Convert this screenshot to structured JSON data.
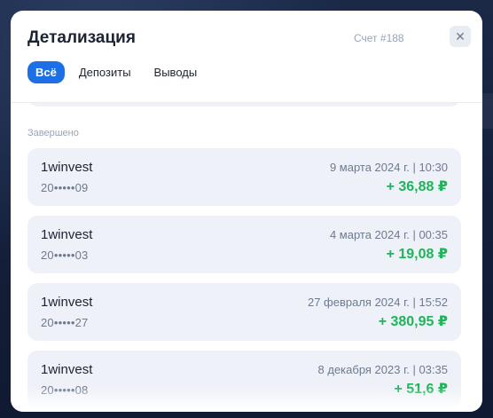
{
  "modal": {
    "title": "Детализация",
    "account_label": "Счет #188",
    "close_icon": "close-icon",
    "tabs": [
      {
        "label": "Всё",
        "active": true
      },
      {
        "label": "Депозиты",
        "active": false
      },
      {
        "label": "Выводы",
        "active": false
      }
    ],
    "section_label": "Завершено",
    "transactions": [
      {
        "name": "1winvest",
        "account": "20•••••09",
        "date": "9 марта 2024 г. | 10:30",
        "amount": "+ 36,88 ₽"
      },
      {
        "name": "1winvest",
        "account": "20•••••03",
        "date": "4 марта 2024 г. | 00:35",
        "amount": "+ 19,08 ₽"
      },
      {
        "name": "1winvest",
        "account": "20•••••27",
        "date": "27 февраля 2024 г. | 15:52",
        "amount": "+ 380,95 ₽"
      },
      {
        "name": "1winvest",
        "account": "20•••••08",
        "date": "8 декабря 2023 г. | 03:35",
        "amount": "+ 51,6 ₽"
      }
    ]
  },
  "colors": {
    "accent": "#1d6fe6",
    "amount_positive": "#1fb45a",
    "card_bg": "#eef1f7",
    "backdrop": "#14203a"
  }
}
